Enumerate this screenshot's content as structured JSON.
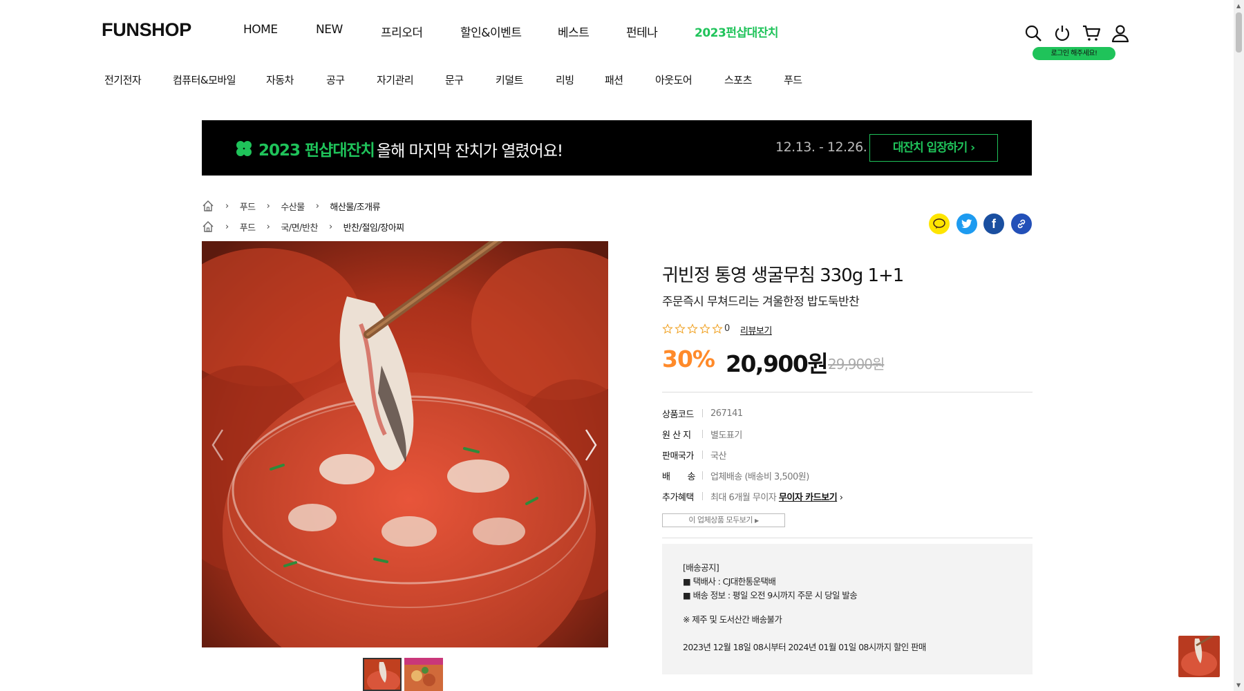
{
  "header": {
    "logo": "FUNSHOP",
    "nav": [
      "HOME",
      "NEW",
      "프리오더",
      "할인&이벤트",
      "베스트",
      "펀테나",
      "2023펀샵대잔치"
    ],
    "login_badge": "로그인 해주세요!",
    "icons": [
      "search-icon",
      "power-icon",
      "cart-icon",
      "user-icon"
    ]
  },
  "categories": [
    "전기전자",
    "컴퓨터&모바일",
    "자동차",
    "공구",
    "자기관리",
    "문구",
    "키덜트",
    "리빙",
    "패션",
    "아웃도어",
    "스포츠",
    "푸드"
  ],
  "banner": {
    "event_name": "2023 펀샵대잔치",
    "message": "올해 마지막 잔치가 열렸어요!",
    "period": "12.13. - 12.26.",
    "cta": "대잔치 입장하기"
  },
  "breadcrumbs": [
    [
      "푸드",
      "수산물",
      "해산물/조개류"
    ],
    [
      "푸드",
      "국/면/반찬",
      "반찬/절임/장아찌"
    ]
  ],
  "product": {
    "title": "귀빈정 통영 생굴무침 330g 1+1",
    "subtitle": "주문즉시 무쳐드리는 겨울한정 밥도둑반찬",
    "rating": 0,
    "review_count": "0",
    "review_link": "리뷰보기",
    "discount_rate": "30%",
    "price": "20,900원",
    "original_price": "29,900원",
    "info": [
      {
        "label": "상품코드",
        "value": "267141"
      },
      {
        "label": "원 산 지",
        "value": "별도표기"
      },
      {
        "label": "판매국가",
        "value": "국산"
      },
      {
        "label": "배　　송",
        "value": "업체배송 (배송비 3,500원)"
      },
      {
        "label": "추가혜택",
        "value": "최대 6개월 무이자",
        "link": "무이자 카드보기"
      }
    ],
    "vendor_button": "이 업체상품 모두보기",
    "notice": [
      "[배송공지]",
      "■ 택배사 : CJ대한통운택배",
      "■ 배송 정보 : 평일 오전 9시까지 주문 시 당일 발송",
      "※ 제주 및 도서산간 배송불가",
      "2023년 12월 18일 08시부터 2024년 01월 01일 08시까지 할인 판매"
    ]
  },
  "colors": {
    "accent": "#1fc35a",
    "discount": "#ff8a2a",
    "banner_bg": "#000000"
  }
}
